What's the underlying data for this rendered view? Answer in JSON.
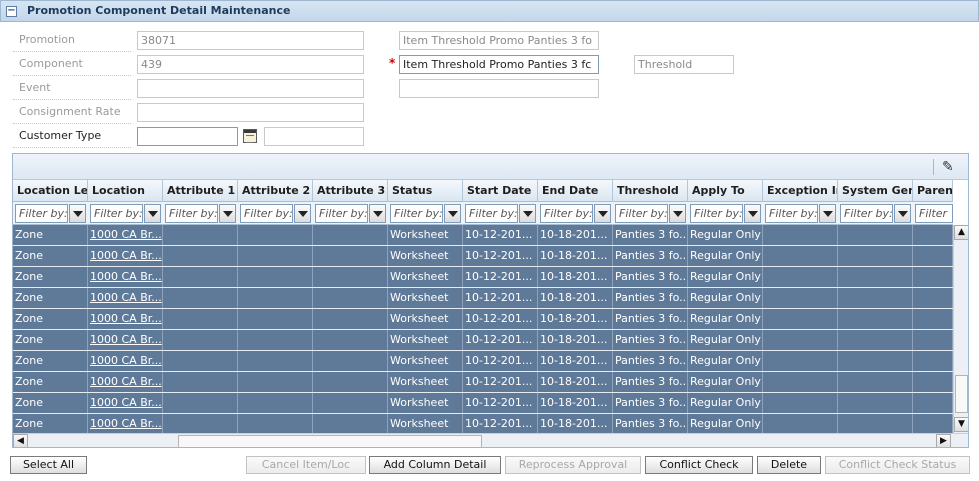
{
  "panel": {
    "title": "Promotion Component Detail Maintenance"
  },
  "form": {
    "promotion_label": "Promotion",
    "promotion_value": "38071",
    "promotion_desc": "Item Threshold Promo Panties 3 fo",
    "component_label": "Component",
    "component_value": "439",
    "component_desc": "Item Threshold Promo Panties 3 fc",
    "component_required": "*",
    "component_type": "Threshold",
    "event_label": "Event",
    "event_value": "",
    "event_desc": "",
    "consignment_label": "Consignment Rate",
    "consignment_value": "",
    "customer_type_label": "Customer Type",
    "customer_type_value": "",
    "customer_type_desc": ""
  },
  "grid": {
    "columns": [
      "Location Level",
      "Location",
      "Attribute 1",
      "Attribute 2",
      "Attribute 3",
      "Status",
      "Start Date",
      "End Date",
      "Threshold",
      "Apply To",
      "Exception Ind",
      "System Generated",
      "Parent"
    ],
    "filter_placeholder": "Filter by:",
    "filter_last": "Filter",
    "rows": [
      [
        "Zone",
        "1000 CA Br...",
        "",
        "",
        "",
        "Worksheet",
        "10-12-201...",
        "10-18-201...",
        "Panties 3 fo...",
        "Regular Only",
        "",
        "",
        ""
      ],
      [
        "Zone",
        "1000 CA Br...",
        "",
        "",
        "",
        "Worksheet",
        "10-12-201...",
        "10-18-201...",
        "Panties 3 fo...",
        "Regular Only",
        "",
        "",
        ""
      ],
      [
        "Zone",
        "1000 CA Br...",
        "",
        "",
        "",
        "Worksheet",
        "10-12-201...",
        "10-18-201...",
        "Panties 3 fo...",
        "Regular Only",
        "",
        "",
        ""
      ],
      [
        "Zone",
        "1000 CA Br...",
        "",
        "",
        "",
        "Worksheet",
        "10-12-201...",
        "10-18-201...",
        "Panties 3 fo...",
        "Regular Only",
        "",
        "",
        ""
      ],
      [
        "Zone",
        "1000 CA Br...",
        "",
        "",
        "",
        "Worksheet",
        "10-12-201...",
        "10-18-201...",
        "Panties 3 fo...",
        "Regular Only",
        "",
        "",
        ""
      ],
      [
        "Zone",
        "1000 CA Br...",
        "",
        "",
        "",
        "Worksheet",
        "10-12-201...",
        "10-18-201...",
        "Panties 3 fo...",
        "Regular Only",
        "",
        "",
        ""
      ],
      [
        "Zone",
        "1000 CA Br...",
        "",
        "",
        "",
        "Worksheet",
        "10-12-201...",
        "10-18-201...",
        "Panties 3 fo...",
        "Regular Only",
        "",
        "",
        ""
      ],
      [
        "Zone",
        "1000 CA Br...",
        "",
        "",
        "",
        "Worksheet",
        "10-12-201...",
        "10-18-201...",
        "Panties 3 fo...",
        "Regular Only",
        "",
        "",
        ""
      ],
      [
        "Zone",
        "1000 CA Br...",
        "",
        "",
        "",
        "Worksheet",
        "10-12-201...",
        "10-18-201...",
        "Panties 3 fo...",
        "Regular Only",
        "",
        "",
        ""
      ],
      [
        "Zone",
        "1000 CA Br...",
        "",
        "",
        "",
        "Worksheet",
        "10-12-201...",
        "10-18-201...",
        "Panties 3 fo...",
        "Regular Only",
        "",
        "",
        ""
      ]
    ]
  },
  "buttons": {
    "select_all": "Select All",
    "cancel_item_loc": "Cancel Item/Loc",
    "add_column_detail": "Add Column Detail",
    "reprocess_approval": "Reprocess Approval",
    "conflict_check": "Conflict Check",
    "delete": "Delete",
    "conflict_check_status": "Conflict Check Status"
  },
  "icons": {
    "collapse": "collapse-icon",
    "calendar": "calendar-icon",
    "pencil": "pencil-icon",
    "scroll_up": "arrow-up-icon",
    "scroll_down": "arrow-down-icon",
    "scroll_left": "arrow-left-icon",
    "scroll_right": "arrow-right-icon"
  },
  "colors": {
    "selected_row": "#5f7a99",
    "header_bg": "#c3d7ea",
    "required": "#cc0000"
  }
}
